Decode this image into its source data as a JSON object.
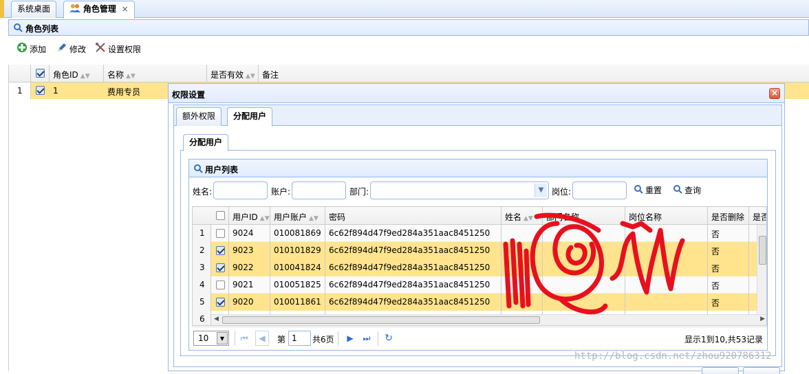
{
  "tabs": [
    {
      "label": "系统桌面"
    },
    {
      "label": "角色管理"
    }
  ],
  "role_panel": {
    "title": "角色列表",
    "toolbar": {
      "add": "添加",
      "edit": "修改",
      "perm": "设置权限"
    },
    "columns": [
      "角色ID",
      "名称",
      "是否有效",
      "备注"
    ],
    "rows": [
      {
        "num": "1",
        "id": "1",
        "name": "费用专员",
        "checked": true
      }
    ]
  },
  "dialog": {
    "title": "权限设置",
    "tabs": [
      "额外权限",
      "分配用户"
    ],
    "inner_tab": "分配用户",
    "user_panel": {
      "title": "用户列表",
      "search": {
        "name_label": "姓名:",
        "account_label": "账户:",
        "dept_label": "部门:",
        "post_label": "岗位:",
        "reset": "重置",
        "query": "查询"
      },
      "columns": [
        "用户ID",
        "用户账户",
        "密码",
        "姓名",
        "部门名称",
        "岗位名称",
        "是否删除",
        "是否"
      ],
      "rows": [
        {
          "num": "1",
          "id": "9024",
          "account": "010081869",
          "pwd": "6c62f894d47f9ed284a351aac8451250",
          "deleted": "否",
          "checked": false
        },
        {
          "num": "2",
          "id": "9023",
          "account": "010101829",
          "pwd": "6c62f894d47f9ed284a351aac8451250",
          "deleted": "否",
          "checked": true
        },
        {
          "num": "3",
          "id": "9022",
          "account": "010041824",
          "pwd": "6c62f894d47f9ed284a351aac8451250",
          "deleted": "否",
          "checked": true
        },
        {
          "num": "4",
          "id": "9021",
          "account": "010051825",
          "pwd": "6c62f894d47f9ed284a351aac8451250",
          "deleted": "否",
          "checked": false
        },
        {
          "num": "5",
          "id": "9020",
          "account": "010011861",
          "pwd": "6c62f894d47f9ed284a351aac8451250",
          "deleted": "否",
          "checked": true
        },
        {
          "num": "6"
        }
      ],
      "pager": {
        "page_size": "10",
        "page_prefix": "第",
        "page_value": "1",
        "page_total": "共6页",
        "summary": "显示1到10,共53记录"
      }
    }
  },
  "watermark": "http://blog.csdn.net/zhou920786312",
  "colors": {
    "accent": "#95b8e7",
    "selected_row": "#ffe48d",
    "header": "#e0ecff",
    "scribble": "#e8101e"
  }
}
